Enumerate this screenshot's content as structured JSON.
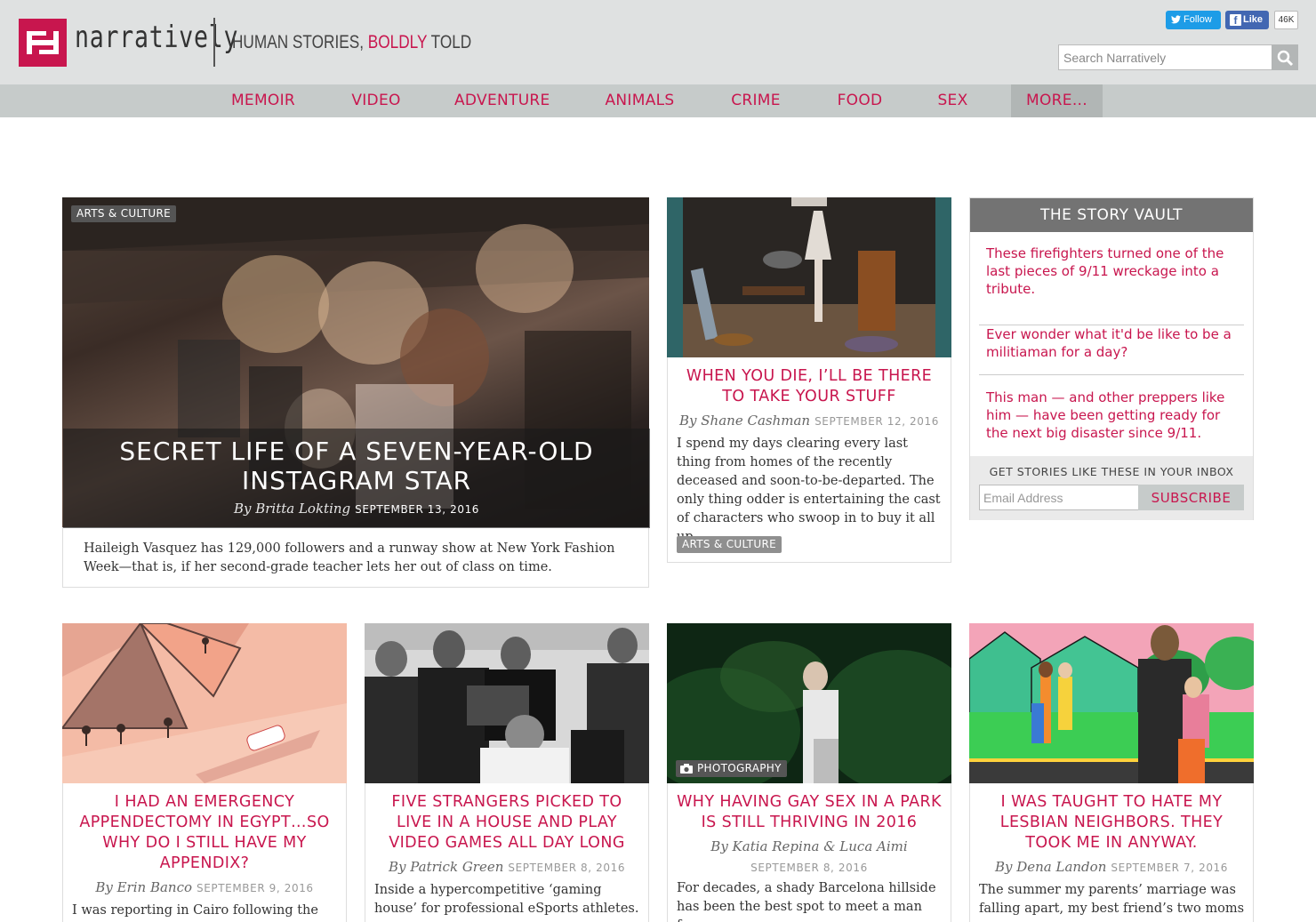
{
  "header": {
    "logo_word": "narratively",
    "tagline_a": "HUMAN STORIES, ",
    "tagline_b": "BOLDLY",
    "tagline_c": " TOLD",
    "twitter_label": "Follow",
    "facebook_label": "Like",
    "facebook_count": "46K",
    "search_placeholder": "Search Narratively"
  },
  "nav": {
    "items": [
      "MEMOIR",
      "VIDEO",
      "ADVENTURE",
      "ANIMALS",
      "CRIME",
      "FOOD",
      "SEX",
      "MORE..."
    ]
  },
  "feature": {
    "tag": "ARTS & CULTURE",
    "title": "SECRET LIFE OF A SEVEN-YEAR-OLD INSTAGRAM STAR",
    "byline": "By Britta Lokting",
    "date": "SEPTEMBER 13, 2016",
    "excerpt": "Haileigh Vasquez has 129,000 followers and a runway show at New York Fashion Week—that is, if her second-grade teacher lets her out of class on time."
  },
  "story2": {
    "title": "WHEN YOU DIE, I’LL BE THERE TO TAKE YOUR STUFF",
    "byline": "By Shane Cashman",
    "date": "SEPTEMBER 12, 2016",
    "excerpt": "I spend my days clearing every last thing from homes of the recently deceased and soon-to-be-departed. The only thing odder is entertaining the cast of characters who swoop in to buy it all up.",
    "tag": "ARTS & CULTURE"
  },
  "vault": {
    "heading": "THE STORY VAULT",
    "items": [
      "These firefighters turned one of the last pieces of 9/11 wreckage into a tribute.",
      "Ever wonder what it'd be like to be a militiaman for a day?",
      "This man — and other preppers like him — have been getting ready for the next big disaster since 9/11."
    ],
    "newsletter_label": "GET STORIES LIKE THESE IN YOUR INBOX",
    "email_placeholder": "Email Address",
    "subscribe_label": "SUBSCRIBE"
  },
  "row2": [
    {
      "title": "I HAD AN EMERGENCY APPENDECTOMY IN EGYPT…SO WHY DO I STILL HAVE MY APPENDIX?",
      "byline": "By Erin Banco",
      "date": "SEPTEMBER 9, 2016",
      "excerpt": "I was reporting in Cairo following the Arab"
    },
    {
      "title": "FIVE STRANGERS PICKED TO LIVE IN A HOUSE AND PLAY VIDEO GAMES ALL DAY LONG",
      "byline": "By Patrick Green",
      "date": "SEPTEMBER 8, 2016",
      "excerpt": "Inside a hypercompetitive ‘gaming house’ for professional eSports athletes."
    },
    {
      "tag": "PHOTOGRAPHY",
      "title": "WHY HAVING GAY SEX IN A PARK IS STILL THRIVING IN 2016",
      "byline": "By Katia Repina & Luca Aimi",
      "date": "SEPTEMBER 8, 2016",
      "excerpt": "For decades, a shady Barcelona hillside has been the best spot to meet a man for"
    },
    {
      "title": "I WAS TAUGHT TO HATE MY LESBIAN NEIGHBORS. THEY TOOK ME IN ANYWAY.",
      "byline": "By Dena Landon",
      "date": "SEPTEMBER 7, 2016",
      "excerpt": "The summer my parents’ marriage was falling apart, my best friend’s two moms"
    }
  ],
  "colors": {
    "brand": "#c8164e",
    "header_bg": "#dfe1e1",
    "nav_bg": "#c6cbca"
  },
  "icons": [
    "logo-mark-icon",
    "twitter-bird-icon",
    "facebook-f-icon",
    "search-icon",
    "camera-icon"
  ]
}
